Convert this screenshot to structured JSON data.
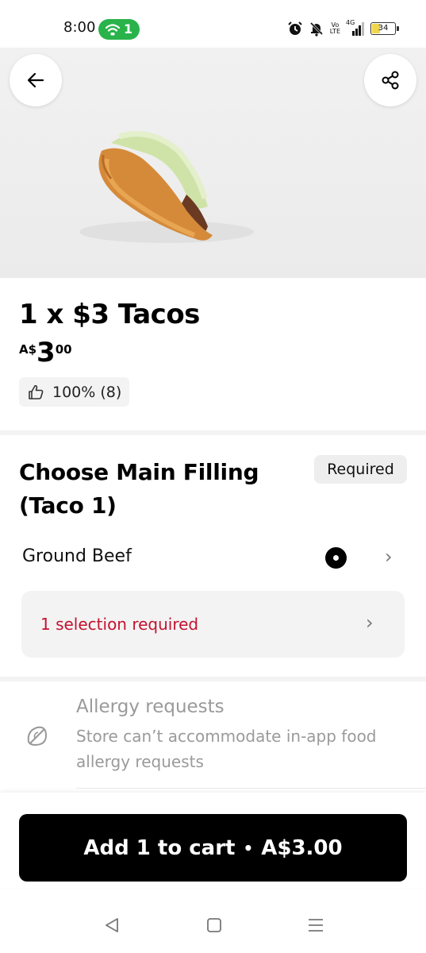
{
  "status_bar": {
    "time": "8:00",
    "hotspot_count": "1",
    "network_top": "Vo",
    "network_bottom": "LTE",
    "signal_type": "4G",
    "battery_level": "34",
    "battery_fraction": 0.34,
    "icons": [
      "hotspot-icon",
      "alarm-icon",
      "bell-muted-icon",
      "volte-icon",
      "signal-icon",
      "battery-icon"
    ]
  },
  "header": {
    "back_icon": "arrow-left-icon",
    "share_icon": "share-icon",
    "hero_image": "taco-image"
  },
  "product": {
    "title": "1 x $3 Tacos",
    "price_currency": "A$",
    "price_integer": "3",
    "price_cents": "00",
    "rating": "100% (8)",
    "rating_icon": "thumbs-up-icon"
  },
  "customization": {
    "title": "Choose Main Filling (Taco 1)",
    "required_label": "Required",
    "option_label": "Ground Beef",
    "option_selected": true,
    "error_message": "1 selection required",
    "error_color": "#c4122f"
  },
  "allergy": {
    "icon": "allergy-leaf-icon",
    "title": "Allergy requests",
    "description": "Store can’t accommodate in-app food allergy requests"
  },
  "cart": {
    "button_label": "Add 1 to cart",
    "separator": "•",
    "button_price": "A$3.00"
  },
  "nav": {
    "icons": [
      "nav-back-icon",
      "nav-home-icon",
      "nav-menu-icon"
    ]
  },
  "colors": {
    "hotspot_green": "#29b34a",
    "battery_yellow": "#f1d64c",
    "cta_background": "#000000"
  }
}
